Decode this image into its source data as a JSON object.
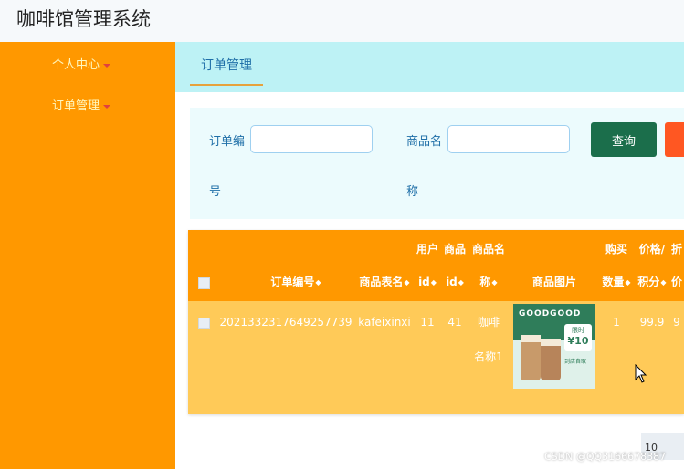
{
  "header": {
    "title": "咖啡馆管理系统"
  },
  "sidebar": {
    "items": [
      {
        "label": "个人中心"
      },
      {
        "label": "订单管理"
      }
    ]
  },
  "tabs": [
    {
      "label": "订单管理"
    }
  ],
  "search": {
    "order_no_label_1": "订单编",
    "order_no_label_2": "号",
    "order_no_value": "",
    "product_label_1": "商品名",
    "product_label_2": "称",
    "product_value": "",
    "query_label": "查询"
  },
  "table": {
    "headers": {
      "order_no": "订单编号",
      "product_table": "商品表名",
      "user_id_1": "用户",
      "user_id_2": "id",
      "product_id_1": "商品",
      "product_id_2": "id",
      "product_name_1": "商品名",
      "product_name_2": "称",
      "product_image": "商品图片",
      "buy_qty_1": "购买",
      "buy_qty_2": "数量",
      "price_1": "价格/",
      "price_2": "积分",
      "col_last_1": "折",
      "col_last_2": "价"
    },
    "rows": [
      {
        "order_no": "2021332317649257739",
        "product_table": "kafeixinxi",
        "user_id": "11",
        "product_id": "41",
        "product_name_1": "咖啡",
        "product_name_2": "名称1",
        "qty": "1",
        "price": "99.9",
        "last": "9"
      }
    ],
    "thumb": {
      "brand": "GOODGOOD",
      "tag": "限时",
      "price": "¥10",
      "caption": "到店自取"
    }
  },
  "pager": {
    "page_size": "10"
  },
  "watermark": "CSDN @QQ3166678387",
  "colors": {
    "sidebar": "#ff9800",
    "tabbar": "#bdf2f5",
    "query": "#1b6e4b",
    "reset": "#ff5722"
  }
}
